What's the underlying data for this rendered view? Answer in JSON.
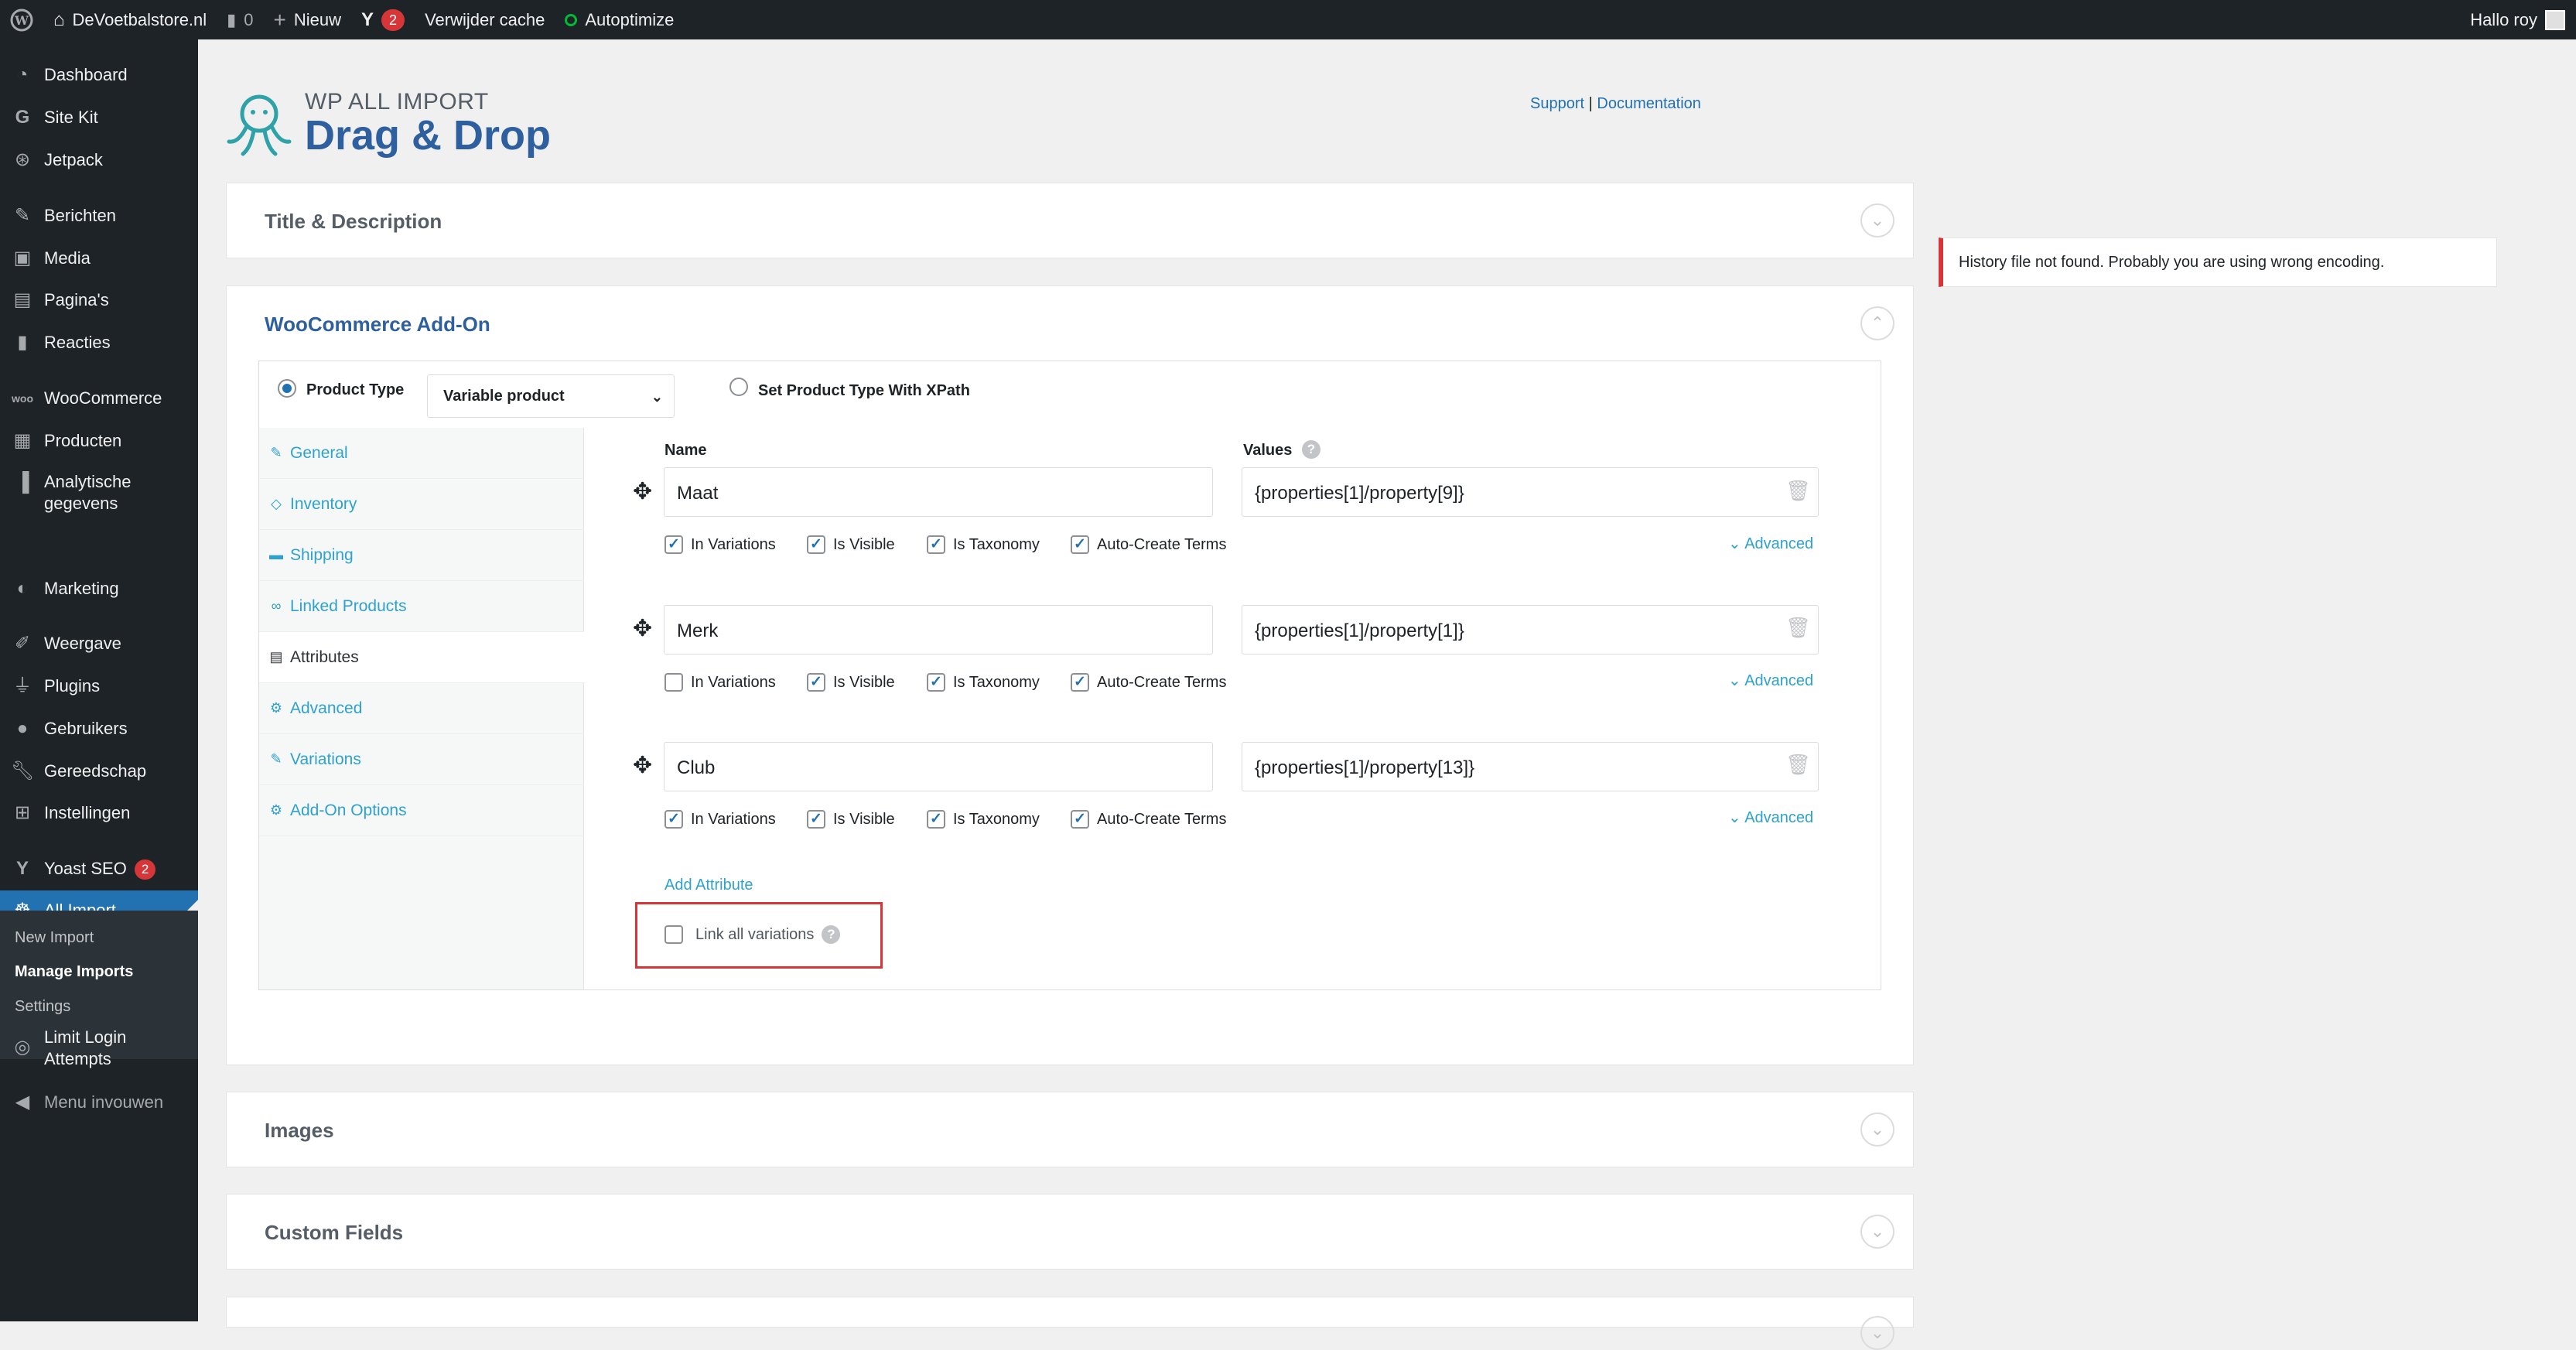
{
  "admin_bar": {
    "site_name": "DeVoetbalstore.nl",
    "comments_count": "0",
    "new_label": "Nieuw",
    "yoast_badge": "2",
    "cache_label": "Verwijder cache",
    "autoptimize_label": "Autoptimize",
    "greeting": "Hallo roy"
  },
  "sidebar": {
    "items": [
      {
        "label": "Dashboard",
        "icon": "dashboard-icon"
      },
      {
        "label": "Site Kit",
        "icon": "google-icon"
      },
      {
        "label": "Jetpack",
        "icon": "jetpack-icon"
      },
      {
        "label": "Berichten",
        "icon": "pin-icon"
      },
      {
        "label": "Media",
        "icon": "media-icon"
      },
      {
        "label": "Pagina's",
        "icon": "page-icon"
      },
      {
        "label": "Reacties",
        "icon": "comment-icon"
      },
      {
        "label": "WooCommerce",
        "icon": "woo-icon"
      },
      {
        "label": "Producten",
        "icon": "archive-icon"
      },
      {
        "label": "Analytische gegevens",
        "icon": "chart-icon"
      },
      {
        "label": "Marketing",
        "icon": "megaphone-icon"
      },
      {
        "label": "Weergave",
        "icon": "brush-icon"
      },
      {
        "label": "Plugins",
        "icon": "plugin-icon"
      },
      {
        "label": "Gebruikers",
        "icon": "users-icon"
      },
      {
        "label": "Gereedschap",
        "icon": "wrench-icon"
      },
      {
        "label": "Instellingen",
        "icon": "settings-icon"
      },
      {
        "label": "Yoast SEO",
        "icon": "yoast-icon",
        "badge": "2"
      },
      {
        "label": "All Import",
        "icon": "octopus-icon"
      },
      {
        "label": "Limit Login Attempts",
        "icon": "fingerprint-icon"
      },
      {
        "label": "Menu invouwen",
        "icon": "collapse-icon"
      }
    ],
    "submenu": [
      "New Import",
      "Manage Imports",
      "Settings"
    ],
    "accent": "#2271b1"
  },
  "header": {
    "logo_sub": "WP ALL IMPORT",
    "logo_main": "Drag & Drop",
    "support": "Support",
    "separator": "|",
    "documentation": "Documentation"
  },
  "notice": "History file not found. Probably you are using wrong encoding.",
  "panels": {
    "title_desc": "Title & Description",
    "woo": "WooCommerce Add-On",
    "images": "Images",
    "custom_fields": "Custom Fields"
  },
  "woo": {
    "product_type_label": "Product Type",
    "product_type_value": "Variable product",
    "xpath_label": "Set Product Type With XPath",
    "tabs": [
      "General",
      "Inventory",
      "Shipping",
      "Linked Products",
      "Attributes",
      "Advanced",
      "Variations",
      "Add-On Options"
    ],
    "name_header": "Name",
    "values_header": "Values",
    "checkbox_labels": [
      "In Variations",
      "Is Visible",
      "Is Taxonomy",
      "Auto-Create Terms"
    ],
    "advanced_label": "Advanced",
    "attributes": [
      {
        "name": "Maat",
        "value": "{properties[1]/property[9]}",
        "checks": [
          true,
          true,
          true,
          true
        ]
      },
      {
        "name": "Merk",
        "value": "{properties[1]/property[1]}",
        "checks": [
          false,
          true,
          true,
          true
        ]
      },
      {
        "name": "Club",
        "value": "{properties[1]/property[13]}",
        "checks": [
          true,
          true,
          true,
          true
        ]
      }
    ],
    "add_attribute": "Add Attribute",
    "link_all": "Link all variations",
    "help": "?"
  }
}
